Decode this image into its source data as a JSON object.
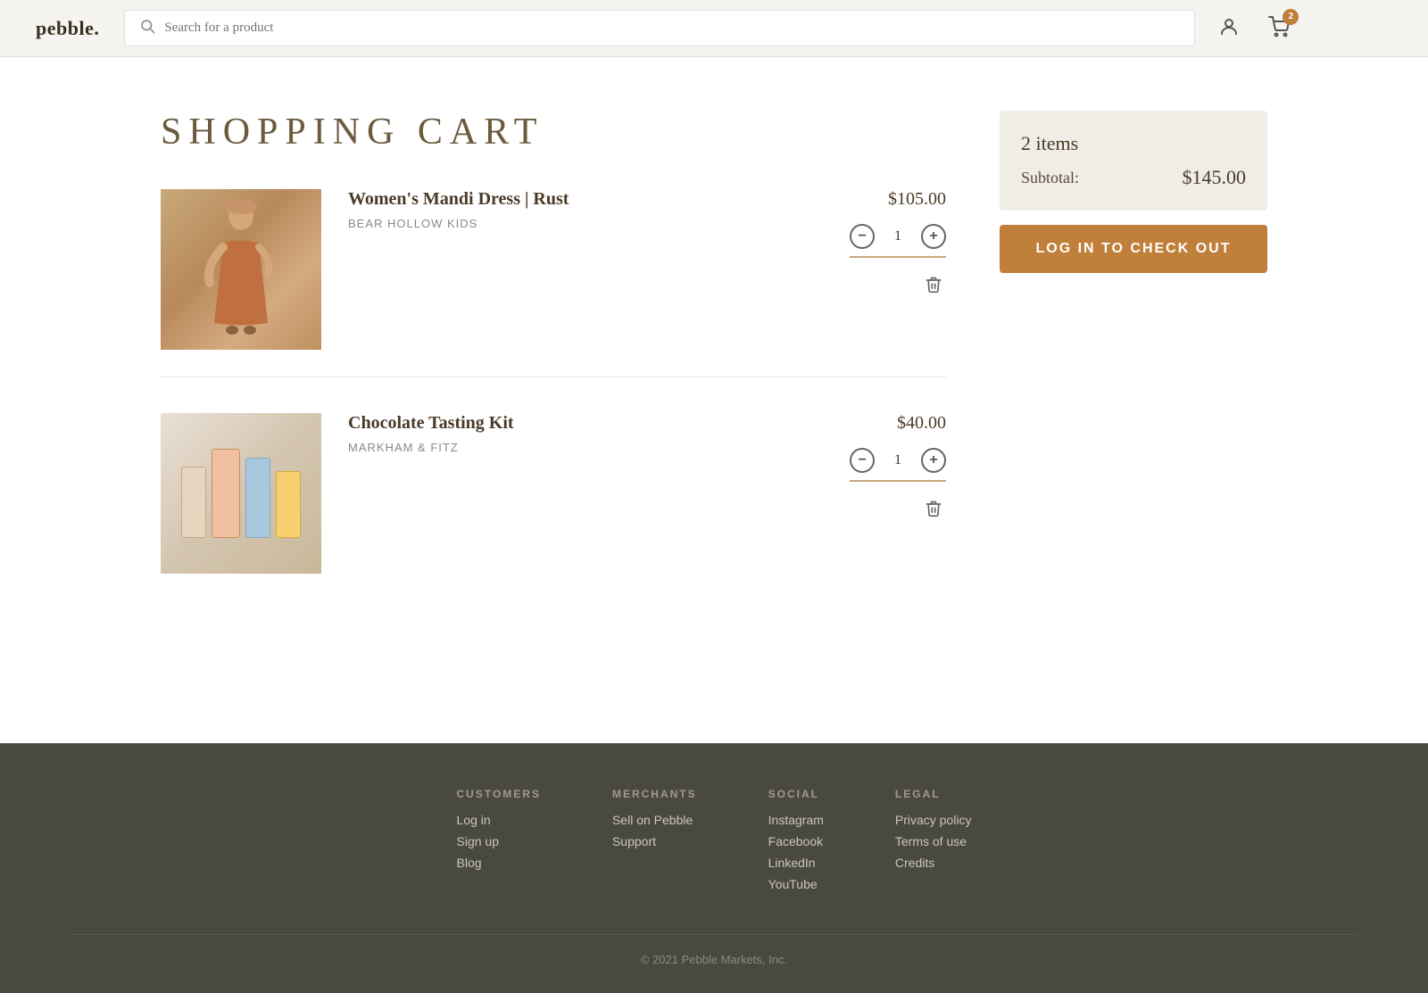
{
  "header": {
    "logo_text": "pebble.",
    "search_placeholder": "Search for a product",
    "cart_badge_count": "2"
  },
  "page": {
    "title": "SHOPPING CART"
  },
  "cart": {
    "items": [
      {
        "id": "item-1",
        "name": "Women's Mandi Dress | Rust",
        "brand": "Bear Hollow Kids",
        "price": "$105.00",
        "quantity": "1",
        "type": "dress"
      },
      {
        "id": "item-2",
        "name": "Chocolate Tasting Kit",
        "brand": "MARKHAM & FITZ",
        "price": "$40.00",
        "quantity": "1",
        "type": "chocolate"
      }
    ]
  },
  "summary": {
    "items_label": "2 items",
    "subtotal_label": "Subtotal:",
    "subtotal_value": "$145.00",
    "checkout_button": "LOG IN TO CHECK OUT"
  },
  "footer": {
    "columns": [
      {
        "heading": "CUSTOMERS",
        "links": [
          "Log in",
          "Sign up",
          "Blog"
        ]
      },
      {
        "heading": "MERCHANTS",
        "links": [
          "Sell on Pebble",
          "Support"
        ]
      },
      {
        "heading": "SOCIAL",
        "links": [
          "Instagram",
          "Facebook",
          "LinkedIn",
          "YouTube"
        ]
      },
      {
        "heading": "LEGAL",
        "links": [
          "Privacy policy",
          "Terms of use",
          "Credits"
        ]
      }
    ],
    "copyright": "© 2021 Pebble Markets, Inc."
  }
}
